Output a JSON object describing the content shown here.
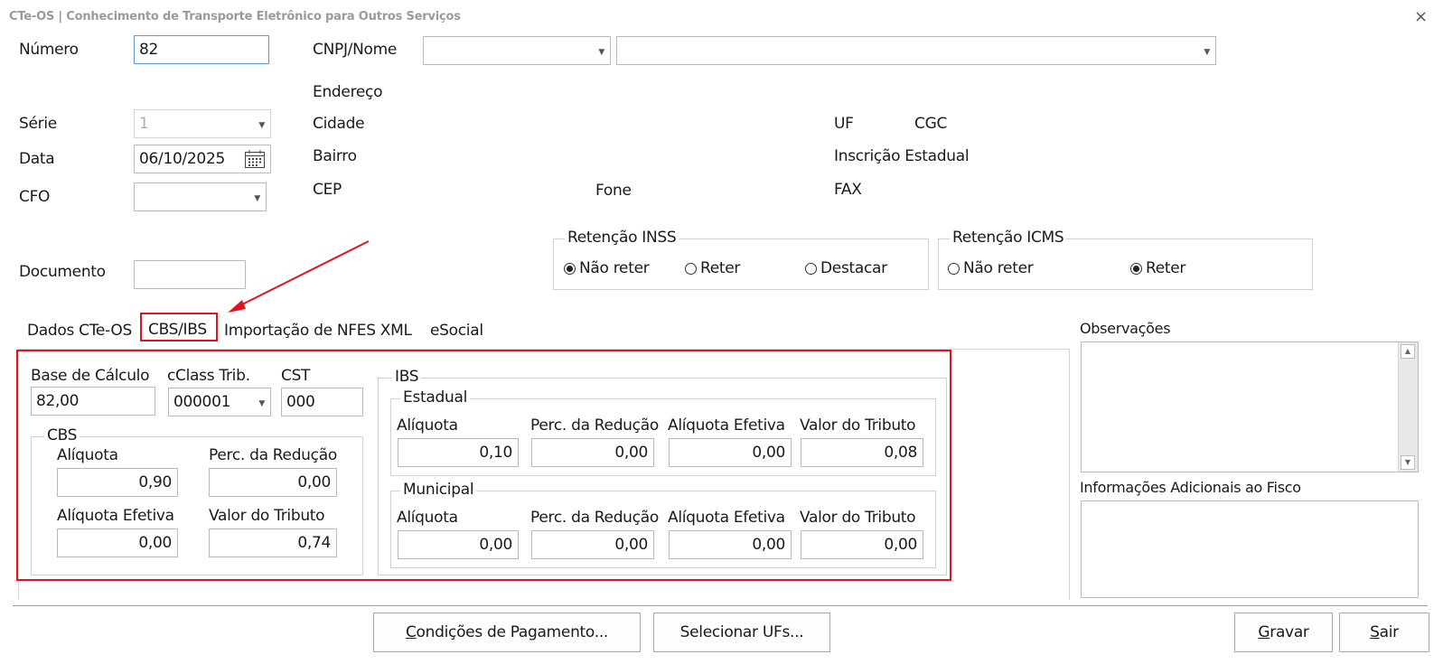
{
  "window": {
    "title": "CTe-OS | Conhecimento de Transporte Eletrônico para Outros Serviços",
    "close": "×"
  },
  "labels": {
    "numero": "Número",
    "serie": "Série",
    "data": "Data",
    "cfo": "CFO",
    "documento": "Documento",
    "cnpj_nome": "CNPJ/Nome",
    "endereco": "Endereço",
    "cidade": "Cidade",
    "bairro": "Bairro",
    "cep": "CEP",
    "fone": "Fone",
    "uf": "UF",
    "cgc": "CGC",
    "inscricao_estadual": "Inscrição Estadual",
    "fax": "FAX"
  },
  "fields": {
    "numero": "82",
    "serie": "1",
    "data": "06/10/2025",
    "cfo": "",
    "documento": "",
    "cnpj": "",
    "nome": ""
  },
  "retencao_inss": {
    "title": "Retenção INSS",
    "options": [
      "Não reter",
      "Reter",
      "Destacar"
    ],
    "selected": "Não reter"
  },
  "retencao_icms": {
    "title": "Retenção ICMS",
    "options": [
      "Não reter",
      "Reter"
    ],
    "selected": "Reter"
  },
  "tabs": [
    "Dados CTe-OS",
    "CBS/IBS",
    "Importação de NFES XML",
    "eSocial"
  ],
  "active_tab": "CBS/IBS",
  "cbs_ibs": {
    "base_calculo_label": "Base de Cálculo",
    "base_calculo": "82,00",
    "cclass_label": "cClass Trib.",
    "cclass": "000001",
    "cst_label": "CST",
    "cst": "000",
    "cbs": {
      "title": "CBS",
      "aliquota_label": "Alíquota",
      "aliquota": "0,90",
      "perc_reducao_label": "Perc. da Redução",
      "perc_reducao": "0,00",
      "aliquota_efetiva_label": "Alíquota Efetiva",
      "aliquota_efetiva": "0,00",
      "valor_tributo_label": "Valor do Tributo",
      "valor_tributo": "0,74"
    },
    "ibs": {
      "title": "IBS",
      "estadual": {
        "title": "Estadual",
        "aliquota_label": "Alíquota",
        "aliquota": "0,10",
        "perc_reducao_label": "Perc. da Redução",
        "perc_reducao": "0,00",
        "aliquota_efetiva_label": "Alíquota Efetiva",
        "aliquota_efetiva": "0,00",
        "valor_tributo_label": "Valor do Tributo",
        "valor_tributo": "0,08"
      },
      "municipal": {
        "title": "Municipal",
        "aliquota_label": "Alíquota",
        "aliquota": "0,00",
        "perc_reducao_label": "Perc. da Redução",
        "perc_reducao": "0,00",
        "aliquota_efetiva_label": "Alíquota Efetiva",
        "aliquota_efetiva": "0,00",
        "valor_tributo_label": "Valor do Tributo",
        "valor_tributo": "0,00"
      }
    }
  },
  "observacoes_label": "Observações",
  "info_adicionais_label": "Informações Adicionais ao Fisco",
  "buttons": {
    "condicoes_first": "C",
    "condicoes_rest": "ondições de Pagamento...",
    "selecionar_ufs": "Selecionar UFs...",
    "gravar_first": "G",
    "gravar_rest": "ravar",
    "sair_first": "S",
    "sair_rest": "air"
  },
  "colors": {
    "highlight": "#e0141e",
    "focus_border": "#5b9bd5"
  }
}
